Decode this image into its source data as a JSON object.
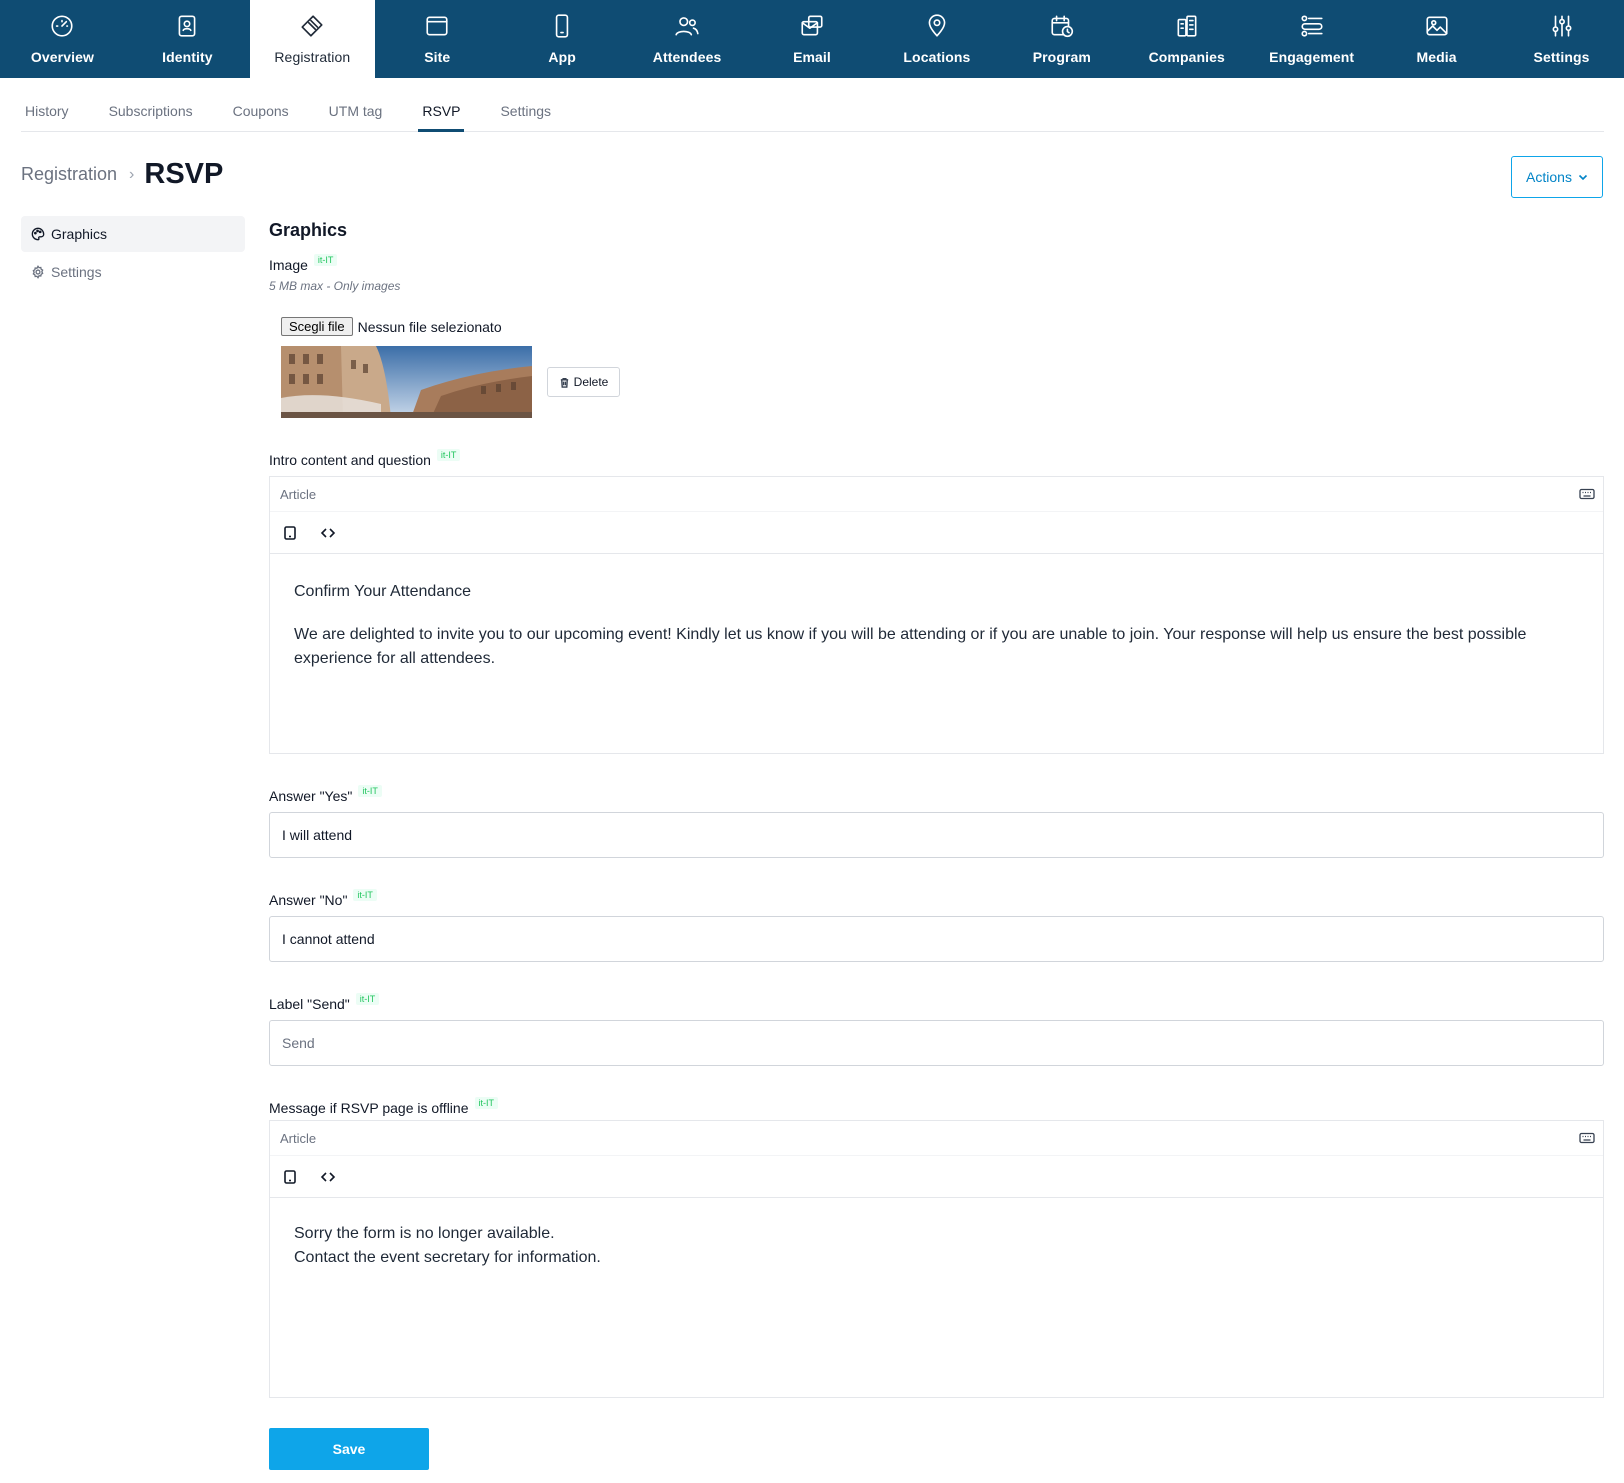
{
  "topnav": {
    "items": [
      {
        "label": "Overview",
        "icon": "dashboard-gauge-icon"
      },
      {
        "label": "Identity",
        "icon": "id-card-icon"
      },
      {
        "label": "Registration",
        "icon": "ticket-icon"
      },
      {
        "label": "Site",
        "icon": "browser-window-icon"
      },
      {
        "label": "App",
        "icon": "smartphone-icon"
      },
      {
        "label": "Attendees",
        "icon": "users-icon"
      },
      {
        "label": "Email",
        "icon": "envelope-icon"
      },
      {
        "label": "Locations",
        "icon": "map-pin-icon"
      },
      {
        "label": "Program",
        "icon": "calendar-clock-icon"
      },
      {
        "label": "Companies",
        "icon": "buildings-icon"
      },
      {
        "label": "Engagement",
        "icon": "user-list-icon"
      },
      {
        "label": "Media",
        "icon": "image-icon"
      },
      {
        "label": "Settings",
        "icon": "sliders-icon"
      }
    ],
    "active": "Registration",
    "background": "#0f4c73"
  },
  "subtabs": {
    "items": [
      "History",
      "Subscriptions",
      "Coupons",
      "UTM tag",
      "RSVP",
      "Settings"
    ],
    "active": "RSVP"
  },
  "header": {
    "parent": "Registration",
    "separator": "›",
    "current": "RSVP",
    "actions_label": "Actions"
  },
  "sidemenu": {
    "items": [
      {
        "label": "Graphics",
        "icon": "palette-icon"
      },
      {
        "label": "Settings",
        "icon": "gear-icon"
      }
    ],
    "active": "Graphics"
  },
  "form": {
    "section_title": "Graphics",
    "locale": "it-IT",
    "image": {
      "label": "Image",
      "hint": "5 MB max - Only images",
      "choose_file_label": "Scegli file",
      "no_file_label": "Nessun file selezionato",
      "delete_label": "Delete"
    },
    "intro": {
      "label": "Intro content and question",
      "editor_type": "Article",
      "heading": "Confirm Your Attendance",
      "body": "We are delighted to invite you to our upcoming event! Kindly let us know if you will be attending or if you are unable to join. Your response will help us ensure the best possible experience for all attendees."
    },
    "answer_yes": {
      "label": "Answer \"Yes\"",
      "value": "I will attend"
    },
    "answer_no": {
      "label": "Answer \"No\"",
      "value": "I cannot attend"
    },
    "label_send": {
      "label": "Label \"Send\"",
      "placeholder": "Send"
    },
    "offline": {
      "label": "Message if RSVP page is offline",
      "editor_type": "Article",
      "line1": "Sorry the form is no longer available.",
      "line2": "Contact the event secretary for information."
    },
    "save_label": "Save"
  },
  "colors": {
    "accent": "#0ea5e9",
    "locale_badge": "#22c55e"
  }
}
